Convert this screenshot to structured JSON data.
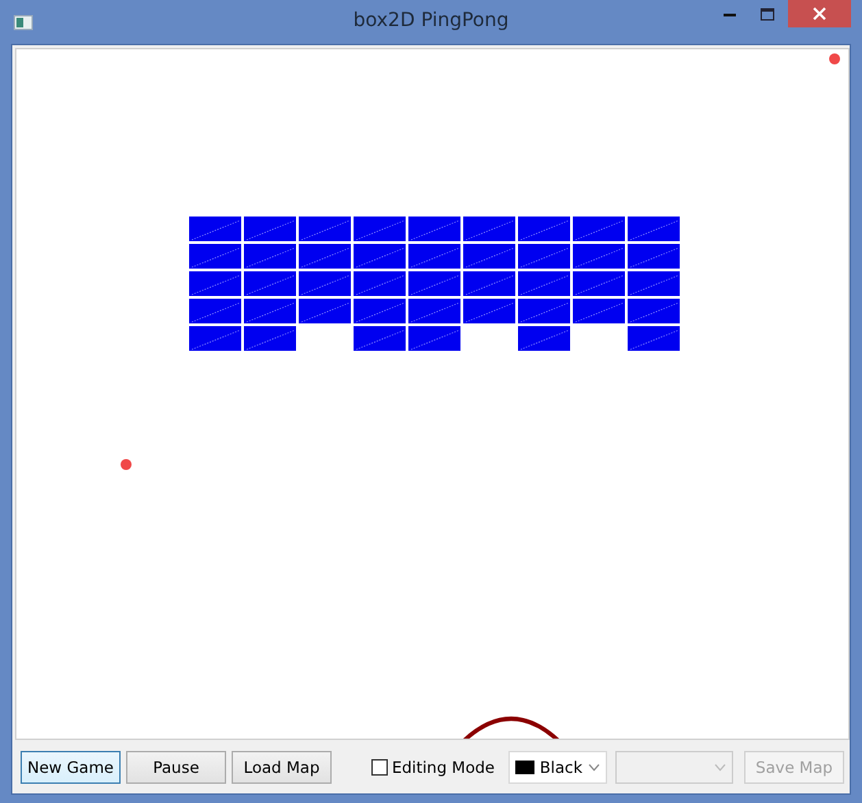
{
  "window": {
    "title": "box2D PingPong"
  },
  "bricks": [
    [
      true,
      true,
      true,
      true,
      true,
      true,
      true,
      true,
      true
    ],
    [
      true,
      true,
      true,
      true,
      true,
      true,
      true,
      true,
      true
    ],
    [
      true,
      true,
      true,
      true,
      true,
      true,
      true,
      true,
      true
    ],
    [
      true,
      true,
      true,
      true,
      true,
      true,
      true,
      true,
      true
    ],
    [
      true,
      true,
      false,
      true,
      true,
      false,
      true,
      false,
      true
    ]
  ],
  "toolbar": {
    "buttons": [
      {
        "label": "New Game",
        "focused": true
      },
      {
        "label": "Pause",
        "focused": false
      },
      {
        "label": "Load Map",
        "focused": false
      }
    ],
    "editing_mode": {
      "label": "Editing Mode",
      "checked": false
    },
    "color_combo": {
      "value": "Black",
      "color": "#000000"
    },
    "second_combo": {
      "disabled": true
    },
    "save_button": {
      "label": "Save Map",
      "disabled": true
    }
  }
}
